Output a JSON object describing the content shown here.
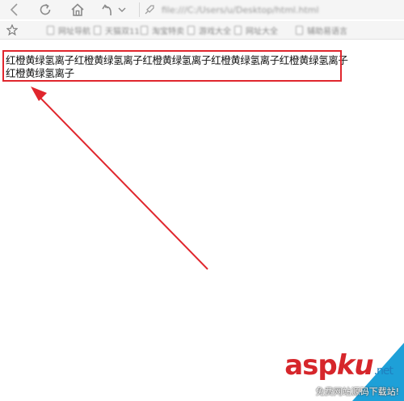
{
  "toolbar": {
    "address": "file:///C:/Users/u/Desktop/html.html"
  },
  "bookmarks": [
    {
      "label": "网址导航"
    },
    {
      "label": "天猫双11"
    },
    {
      "label": "淘宝特卖"
    },
    {
      "label": "游戏大全"
    },
    {
      "label": "网址大全"
    },
    {
      "label": "辅助易语言"
    }
  ],
  "content": {
    "line1": "红橙黄绿氢离子红橙黄绿氢离子红橙黄绿氢离子红橙黄绿氢离子红橙黄绿氢离子",
    "line2": "红橙黄绿氢离子"
  },
  "watermark": {
    "logo_main": "asp",
    "logo_ku": "ku",
    "logo_suffix": ".net",
    "subtitle": "免费网站源码下载站!"
  },
  "colors": {
    "annotation_red": "#e0262d",
    "watermark_blue": "#1ea0d8"
  }
}
